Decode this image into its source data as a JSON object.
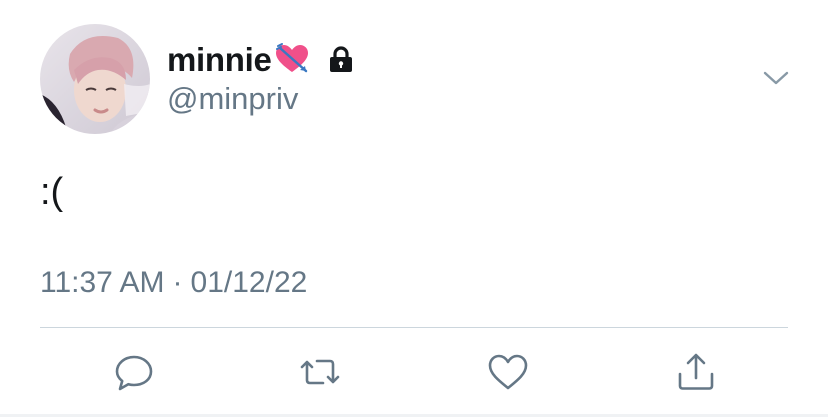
{
  "tweet": {
    "display_name": "minnie",
    "handle": "@minpriv",
    "text": ":(",
    "time": "11:37 AM",
    "separator": "·",
    "date": "01/12/22",
    "protected": true,
    "name_emoji": "heart-with-arrow"
  },
  "icons": {
    "caret": "chevron-down-icon",
    "reply": "reply-icon",
    "retweet": "retweet-icon",
    "like": "like-icon",
    "share": "share-icon",
    "lock": "lock-icon"
  },
  "colors": {
    "text_primary": "#14171a",
    "text_secondary": "#657786",
    "divider": "#ccd6dd",
    "icon": "#657786",
    "heart_emoji": "#f0508a"
  }
}
